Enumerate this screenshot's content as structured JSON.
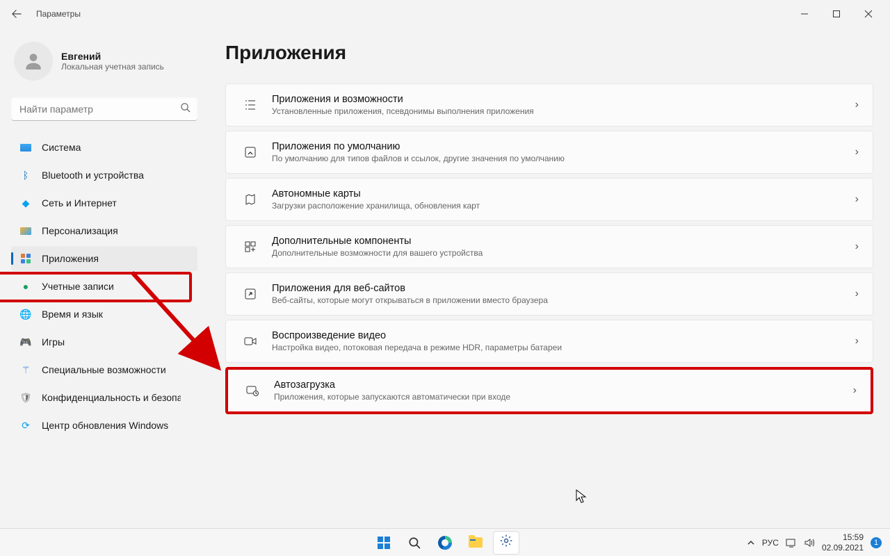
{
  "titlebar": {
    "title": "Параметры"
  },
  "profile": {
    "name": "Евгений",
    "sub": "Локальная учетная запись"
  },
  "search": {
    "placeholder": "Найти параметр"
  },
  "nav": {
    "items": [
      {
        "label": "Система"
      },
      {
        "label": "Bluetooth и устройства"
      },
      {
        "label": "Сеть и Интернет"
      },
      {
        "label": "Персонализация"
      },
      {
        "label": "Приложения"
      },
      {
        "label": "Учетные записи"
      },
      {
        "label": "Время и язык"
      },
      {
        "label": "Игры"
      },
      {
        "label": "Специальные возможности"
      },
      {
        "label": "Конфиденциальность и безопасность"
      },
      {
        "label": "Центр обновления Windows"
      }
    ]
  },
  "page": {
    "title": "Приложения"
  },
  "cards": [
    {
      "title": "Приложения и возможности",
      "desc": "Установленные приложения, псевдонимы выполнения приложения"
    },
    {
      "title": "Приложения по умолчанию",
      "desc": "По умолчанию для типов файлов и ссылок, другие значения по умолчанию"
    },
    {
      "title": "Автономные карты",
      "desc": "Загрузки расположение хранилища, обновления карт"
    },
    {
      "title": "Дополнительные компоненты",
      "desc": "Дополнительные возможности для вашего устройства"
    },
    {
      "title": "Приложения для веб-сайтов",
      "desc": "Веб-сайты, которые могут открываться в приложении вместо браузера"
    },
    {
      "title": "Воспроизведение видео",
      "desc": "Настройка видео, потоковая передача в режиме HDR, параметры батареи"
    },
    {
      "title": "Автозагрузка",
      "desc": "Приложения, которые запускаются автоматически при входе"
    }
  ],
  "taskbar": {
    "lang": "РУС",
    "time": "15:59",
    "date": "02.09.2021",
    "notif": "1"
  }
}
